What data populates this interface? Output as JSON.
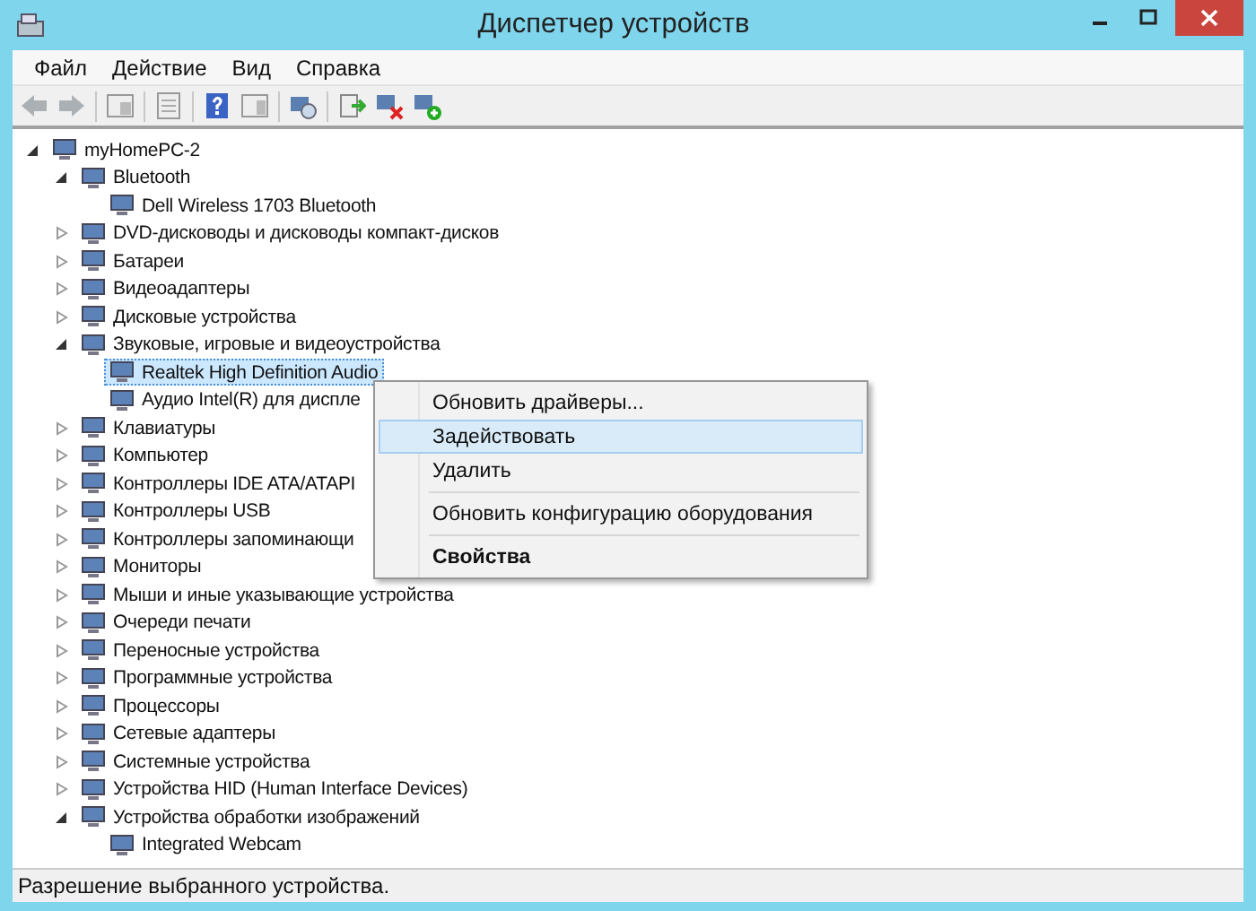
{
  "window": {
    "title": "Диспетчер устройств"
  },
  "menu_bar": [
    "Файл",
    "Действие",
    "Вид",
    "Справка"
  ],
  "tree": {
    "items": [
      {
        "label": "myHomePC-2",
        "expanded": true,
        "selected": false,
        "children": [
          {
            "label": "Bluetooth",
            "expanded": true,
            "selected": false,
            "children": [
              {
                "label": "Dell Wireless 1703 Bluetooth",
                "selected": false
              }
            ]
          },
          {
            "label": "DVD-дисководы и дисководы компакт-дисков",
            "expanded": false,
            "selected": false
          },
          {
            "label": "Батареи",
            "expanded": false,
            "selected": false
          },
          {
            "label": "Видеоадаптеры",
            "expanded": false,
            "selected": false
          },
          {
            "label": "Дисковые устройства",
            "expanded": false,
            "selected": false
          },
          {
            "label": "Звуковые, игровые и видеоустройства",
            "expanded": true,
            "selected": false,
            "children": [
              {
                "label": "Realtek High Definition Audio",
                "selected": true
              },
              {
                "label": "Аудио Intel(R) для диспле",
                "selected": false
              }
            ]
          },
          {
            "label": "Клавиатуры",
            "expanded": false,
            "selected": false
          },
          {
            "label": "Компьютер",
            "expanded": false,
            "selected": false
          },
          {
            "label": "Контроллеры IDE ATA/ATAPI",
            "expanded": false,
            "selected": false
          },
          {
            "label": "Контроллеры USB",
            "expanded": false,
            "selected": false
          },
          {
            "label": "Контроллеры запоминающи",
            "expanded": false,
            "selected": false
          },
          {
            "label": "Мониторы",
            "expanded": false,
            "selected": false
          },
          {
            "label": "Мыши и иные указывающие устройства",
            "expanded": false,
            "selected": false
          },
          {
            "label": "Очереди печати",
            "expanded": false,
            "selected": false
          },
          {
            "label": "Переносные устройства",
            "expanded": false,
            "selected": false
          },
          {
            "label": "Программные устройства",
            "expanded": false,
            "selected": false
          },
          {
            "label": "Процессоры",
            "expanded": false,
            "selected": false
          },
          {
            "label": "Сетевые адаптеры",
            "expanded": false,
            "selected": false
          },
          {
            "label": "Системные устройства",
            "expanded": false,
            "selected": false
          },
          {
            "label": "Устройства HID (Human Interface Devices)",
            "expanded": false,
            "selected": false
          },
          {
            "label": "Устройства обработки изображений",
            "expanded": true,
            "selected": false,
            "children": [
              {
                "label": "Integrated Webcam",
                "selected": false
              }
            ]
          }
        ]
      }
    ]
  },
  "context_menu": {
    "items": [
      {
        "kind": "item",
        "label": "Обновить драйверы...",
        "selected": false,
        "default": false
      },
      {
        "kind": "item",
        "label": "Задействовать",
        "selected": true,
        "default": false
      },
      {
        "kind": "item",
        "label": "Удалить",
        "selected": false,
        "default": false
      },
      {
        "kind": "separator"
      },
      {
        "kind": "item",
        "label": "Обновить конфигурацию оборудования",
        "selected": false,
        "default": false
      },
      {
        "kind": "separator"
      },
      {
        "kind": "item",
        "label": "Свойства",
        "selected": false,
        "default": true
      }
    ]
  },
  "status_bar": "Разрешение выбранного устройства."
}
